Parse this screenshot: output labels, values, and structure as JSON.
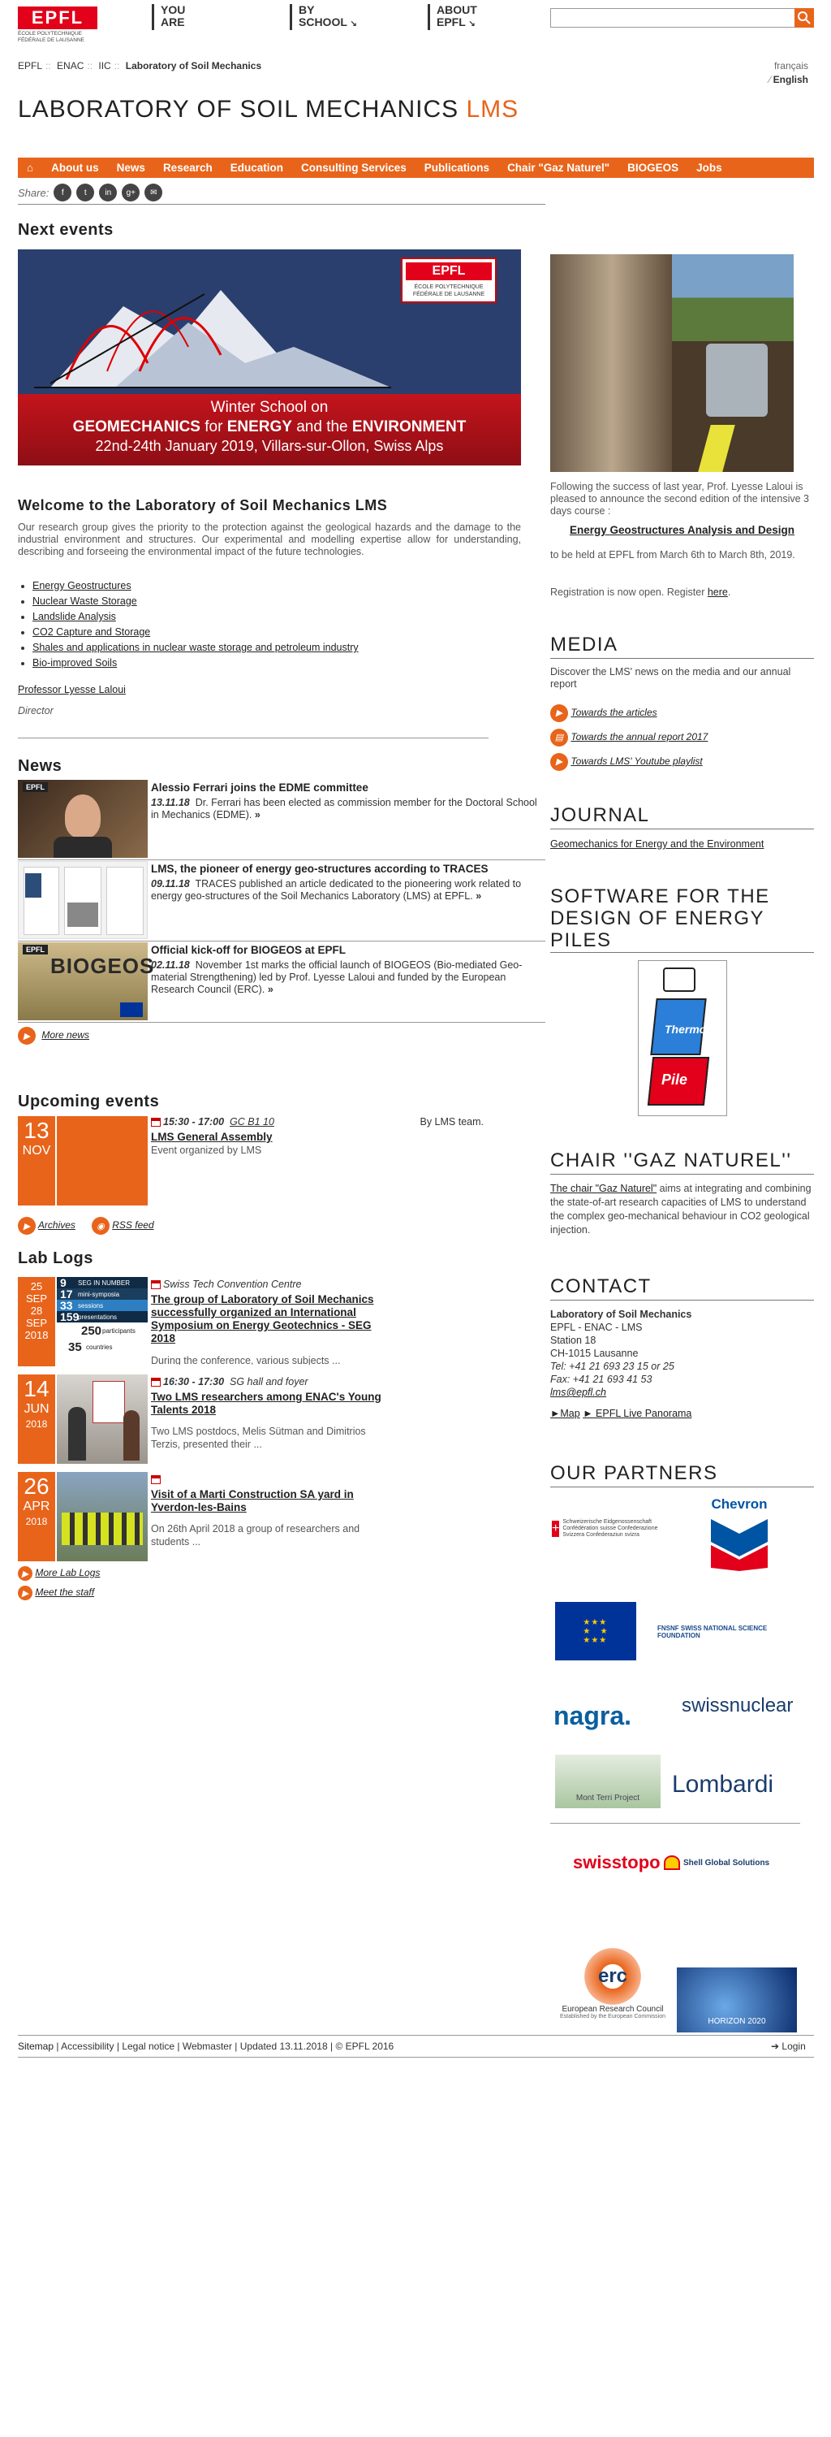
{
  "header": {
    "logo_text": "EPFL",
    "logo_sub": "ÉCOLE POLYTECHNIQUE FÉDÉRALE DE LAUSANNE",
    "nav": [
      {
        "line1": "YOU",
        "line2": "ARE"
      },
      {
        "line1": "BY",
        "line2": "SCHOOL"
      },
      {
        "line1": "ABOUT",
        "line2": "EPFL"
      }
    ],
    "search_placeholder": ""
  },
  "breadcrumb": [
    "EPFL",
    "ENAC",
    "IIC",
    "Laboratory of Soil Mechanics"
  ],
  "languages": {
    "fr": "français",
    "en": "English"
  },
  "page_title": {
    "main": "LABORATORY OF SOIL MECHANICS",
    "accent": "LMS"
  },
  "menu": [
    "About us",
    "News",
    "Research",
    "Education",
    "Consulting Services",
    "Publications",
    "Chair \"Gaz Naturel\"",
    "BIOGEOS",
    "Jobs"
  ],
  "share": {
    "label": "Share:",
    "icons": [
      "f",
      "t",
      "in",
      "g+",
      "✉"
    ]
  },
  "next_events": {
    "heading": "Next events",
    "banner": {
      "logo_text": "EPFL",
      "logo_sub": "ÉCOLE POLYTECHNIQUE FÉDÉRALE DE LAUSANNE",
      "line1": "Winter School on",
      "line2_a": "GEOMECHANICS",
      "line2_b": " for ",
      "line2_c": "ENERGY",
      "line2_d": " and the ",
      "line2_e": "ENVIRONMENT",
      "line3": "22nd-24th January 2019, Villars-sur-Ollon, Swiss Alps"
    }
  },
  "welcome": {
    "title": "Welcome to the Laboratory of Soil Mechanics LMS",
    "text": "Our research group gives the priority to the protection against the geological hazards and the damage to the industrial environment and structures. Our experimental and modelling expertise allow for understanding, describing and forseeing the environmental impact of the future technologies.",
    "list": [
      "Energy Geostructures",
      "Nuclear Waste Storage",
      "Landslide Analysis",
      "CO2 Capture and Storage",
      "Shales and applications in nuclear waste storage and petroleum industry",
      "Bio-improved Soils"
    ],
    "professor": "Professor Lyesse Laloui",
    "role": "Director"
  },
  "news": {
    "heading": "News",
    "items": [
      {
        "title": "Alessio Ferrari joins the EDME committee",
        "date": "13.11.18",
        "text": "Dr. Ferrari has been elected as commission member for the Doctoral School in Mechanics (EDME)."
      },
      {
        "title": "LMS, the pioneer of energy geo-structures according to TRACES",
        "date": "09.11.18",
        "text": "TRACES published an article dedicated to the pioneering work related to energy geo-structures of the Soil Mechanics Laboratory (LMS) at EPFL."
      },
      {
        "title": "Official kick-off for BIOGEOS at EPFL",
        "date": "02.11.18",
        "text": "November 1st marks the official launch of BIOGEOS (Bio-mediated Geo-material Strengthening) led by Prof. Lyesse Laloui and funded by the European Research Council (ERC)."
      }
    ],
    "more": "More news"
  },
  "upcoming": {
    "heading": "Upcoming events",
    "event": {
      "day": "13",
      "month": "NOV",
      "time": "15:30 - 17:00",
      "place": "GC B1 10",
      "by": "By LMS team.",
      "title": "LMS General Assembly",
      "desc": "Event organized by LMS"
    },
    "archives": "Archives",
    "rss": "RSS feed"
  },
  "lablogs": {
    "heading": "Lab Logs",
    "items": [
      {
        "date1": "25",
        "date1b": "SEP",
        "date2": "28",
        "date2b": "SEP",
        "year": "2018",
        "place": "Swiss Tech Convention Centre",
        "title": "The group of Laboratory of Soil Mechanics successfully organized an International Symposium on Energy Geotechnics - SEG 2018",
        "text": "During the conference, various subjects ..."
      },
      {
        "day": "14",
        "month": "JUN",
        "year": "2018",
        "time": "16:30 - 17:30",
        "place": "SG hall and foyer",
        "title": "Two LMS researchers among ENAC's Young Talents 2018",
        "text": "Two LMS postdocs, Melis Sütman and Dimitrios Terzis, presented their ..."
      },
      {
        "day": "26",
        "month": "APR",
        "year": "2018",
        "title": "Visit of a Marti Construction SA yard in Yverdon-les-Bains",
        "text": "On 26th April 2018 a group of researchers and students ..."
      }
    ],
    "seg_stats": [
      {
        "num": "9",
        "label": "SEG IN NUMBER"
      },
      {
        "num": "17",
        "label": "mini-symposia"
      },
      {
        "num": "33",
        "label": "sessions"
      },
      {
        "num": "159",
        "label": "presentations"
      },
      {
        "num": "250",
        "label": "participants"
      },
      {
        "num": "35",
        "label": "countries"
      }
    ],
    "more": "More Lab Logs",
    "staff": "Meet the staff"
  },
  "sidebar": {
    "course": {
      "intro": "Following the success of last year, Prof. Lyesse Laloui is pleased to announce the second edition of the intensive 3 days course :",
      "title": "Energy Geostructures Analysis and Design",
      "dates": "to be held at EPFL from March 6th to March 8th, 2019.",
      "reg": "Registration is now open. Register",
      "here": "here"
    },
    "media": {
      "heading": "MEDIA",
      "text": "Discover the LMS' news on the media and our annual report",
      "links": [
        "Towards the articles",
        "Towards the annual report 2017",
        "Towards LMS' Youtube playlist"
      ]
    },
    "journal": {
      "heading": "JOURNAL",
      "link": "Geomechanics for Energy and the Environment"
    },
    "software": {
      "heading": "SOFTWARE FOR THE DESIGN OF ENERGY PILES",
      "logo_a": "Thermo",
      "logo_b": "Pile"
    },
    "chair": {
      "heading": "CHAIR ''GAZ NATUREL''",
      "link": "The chair \"Gaz Naturel\"",
      "text": " aims at integrating and combining the state-of-art research capacities of LMS to understand the complex geo-mechanical behaviour in CO2 geological injection."
    },
    "contact": {
      "heading": "CONTACT",
      "name": "Laboratory of Soil Mechanics",
      "lines": [
        "EPFL - ENAC - LMS",
        "Station 18",
        "CH-1015 Lausanne"
      ],
      "tel": "Tel: +41 21 693 23 15 or 25",
      "fax": "Fax: +41 21 693 41 53",
      "email": "lms@epfl.ch",
      "map": "►Map",
      "panorama": "► EPFL Live Panorama"
    },
    "partners": {
      "heading": "OUR PARTNERS",
      "items": [
        "Schweizerische Eidgenossenschaft Confédération suisse Confederazione Svizzera Confederaziun svizra",
        "Chevron",
        "EU",
        "FNSNF SWISS NATIONAL SCIENCE FOUNDATION",
        "nagra.",
        "swissnuclear",
        "Mont Terri Project",
        "Lombardi",
        "swisstopo",
        "Shell Global Solutions",
        "erc",
        "European Research Council",
        "Established by the European Commission",
        "HORIZON 2020"
      ]
    }
  },
  "footer": {
    "links": [
      "Sitemap",
      "Accessibility",
      "Legal notice",
      "Webmaster",
      "Updated 13.11.2018",
      "© EPFL 2016"
    ],
    "login": "➔ Login"
  }
}
